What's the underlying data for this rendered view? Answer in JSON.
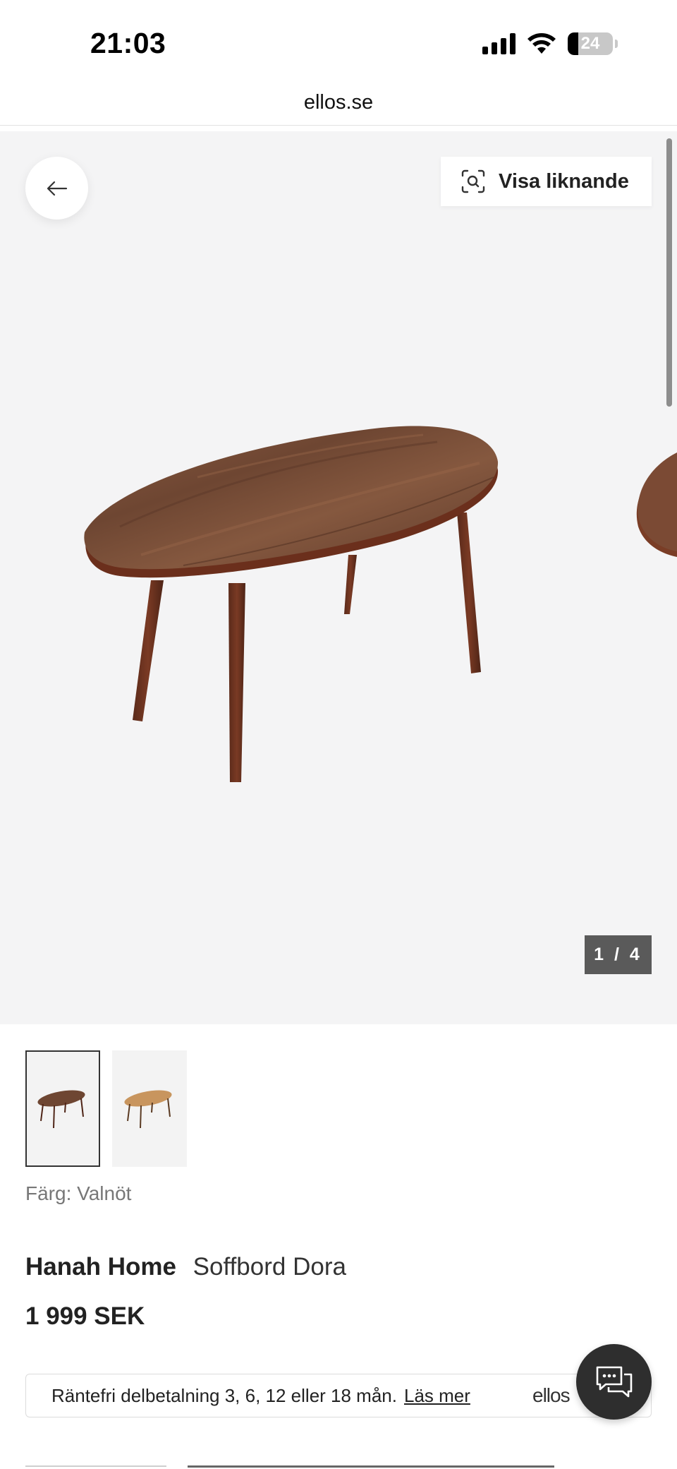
{
  "status_bar": {
    "time": "21:03",
    "battery": "24",
    "battery_level_percent": 24
  },
  "browser": {
    "address": "ellos.se"
  },
  "gallery": {
    "similar_button_label": "Visa liknande",
    "counter": "1 / 4",
    "current_index": 1,
    "total_images": 4,
    "back_icon": "arrow-left-icon",
    "similar_icon": "visual-search-icon"
  },
  "thumbnails": [
    {
      "color": "walnut",
      "active": true
    },
    {
      "color": "oak",
      "active": false
    }
  ],
  "product": {
    "color_label": "Färg: Valnöt",
    "brand": "Hanah Home",
    "name": "Soffbord Dora",
    "price": "1 999 SEK"
  },
  "installment": {
    "text": "Räntefri delbetalning 3, 6, 12 eller 18 mån.",
    "link": "Läs mer",
    "logo": "ellos"
  },
  "chat": {
    "icon": "chat-bubbles-icon"
  },
  "colors": {
    "hero_background": "#f4f4f5",
    "counter_background": "#5a5a5a",
    "chat_button": "#2e2e2e",
    "walnut": "#7a4a33",
    "oak": "#c8955e"
  }
}
